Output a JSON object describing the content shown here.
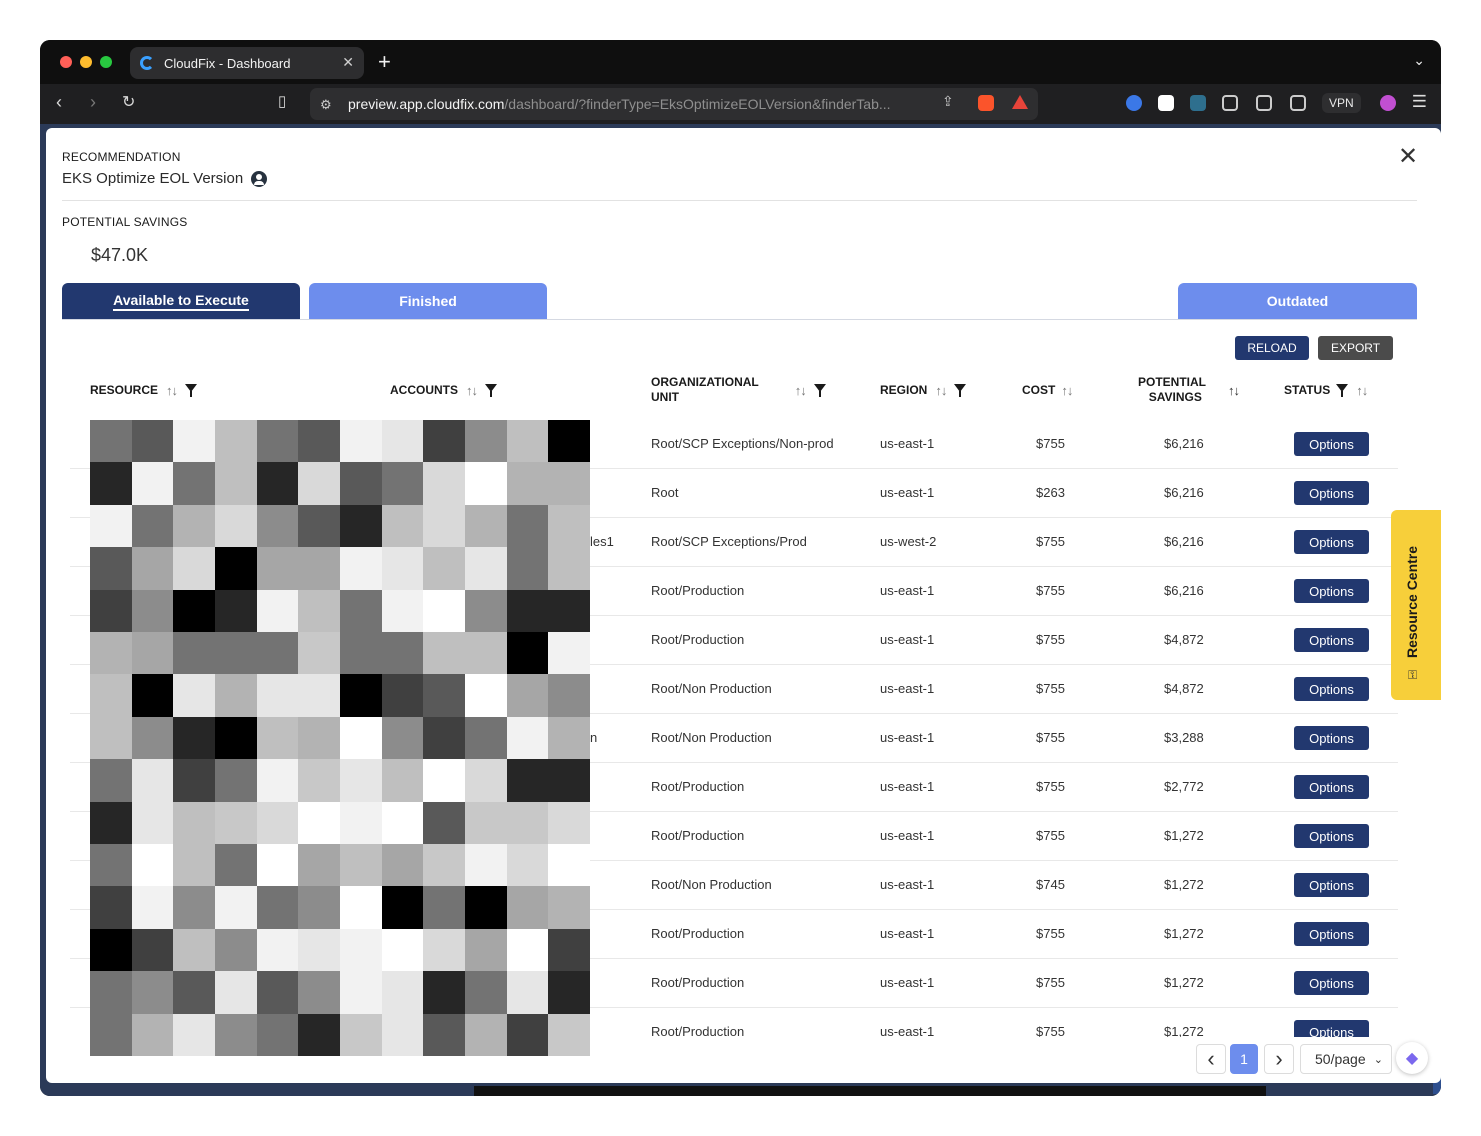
{
  "browser": {
    "tab_title": "CloudFix - Dashboard",
    "new_tab": "+",
    "url_host": "preview.app.cloudfix.com",
    "url_path": "/dashboard/?finderType=EksOptimizeEOLVersion&finderTab...",
    "vpn_label": "VPN",
    "shield_count": "10"
  },
  "modal": {
    "recommendation_label": "RECOMMENDATION",
    "recommendation_name": "EKS Optimize EOL Version",
    "close": "✕",
    "potential_savings_label": "POTENTIAL SAVINGS",
    "potential_savings_value": "$47.0K"
  },
  "tabs": {
    "available": "Available to Execute",
    "finished": "Finished",
    "outdated": "Outdated"
  },
  "actions": {
    "reload": "RELOAD",
    "export": "EXPORT"
  },
  "columns": {
    "resource": "RESOURCE",
    "accounts": "ACCOUNTS",
    "org_unit_line1": "ORGANIZATIONAL",
    "org_unit_line2": "UNIT",
    "region": "REGION",
    "cost": "COST",
    "savings_line1": "POTENTIAL",
    "savings_line2": "SAVINGS",
    "status": "STATUS"
  },
  "sort_glyph": "↑↓",
  "rows": [
    {
      "account_tail": "",
      "org_unit": "Root/SCP Exceptions/Non-prod",
      "region": "us-east-1",
      "cost": "$755",
      "savings": "$6,216",
      "status": "Options"
    },
    {
      "account_tail": "",
      "org_unit": "Root",
      "region": "us-east-1",
      "cost": "$263",
      "savings": "$6,216",
      "status": "Options"
    },
    {
      "account_tail": "les1",
      "org_unit": "Root/SCP Exceptions/Prod",
      "region": "us-west-2",
      "cost": "$755",
      "savings": "$6,216",
      "status": "Options"
    },
    {
      "account_tail": "",
      "org_unit": "Root/Production",
      "region": "us-east-1",
      "cost": "$755",
      "savings": "$6,216",
      "status": "Options"
    },
    {
      "account_tail": "",
      "org_unit": "Root/Production",
      "region": "us-east-1",
      "cost": "$755",
      "savings": "$4,872",
      "status": "Options"
    },
    {
      "account_tail": "",
      "org_unit": "Root/Non Production",
      "region": "us-east-1",
      "cost": "$755",
      "savings": "$4,872",
      "status": "Options"
    },
    {
      "account_tail": "n",
      "org_unit": "Root/Non Production",
      "region": "us-east-1",
      "cost": "$755",
      "savings": "$3,288",
      "status": "Options"
    },
    {
      "account_tail": "",
      "org_unit": "Root/Production",
      "region": "us-east-1",
      "cost": "$755",
      "savings": "$2,772",
      "status": "Options"
    },
    {
      "account_tail": "",
      "org_unit": "Root/Production",
      "region": "us-east-1",
      "cost": "$755",
      "savings": "$1,272",
      "status": "Options"
    },
    {
      "account_tail": "",
      "org_unit": "Root/Non Production",
      "region": "us-east-1",
      "cost": "$745",
      "savings": "$1,272",
      "status": "Options"
    },
    {
      "account_tail": "",
      "org_unit": "Root/Production",
      "region": "us-east-1",
      "cost": "$755",
      "savings": "$1,272",
      "status": "Options"
    },
    {
      "account_tail": "",
      "org_unit": "Root/Production",
      "region": "us-east-1",
      "cost": "$755",
      "savings": "$1,272",
      "status": "Options"
    },
    {
      "account_tail": "",
      "org_unit": "Root/Production",
      "region": "us-east-1",
      "cost": "$755",
      "savings": "$1,272",
      "status": "Options"
    }
  ],
  "pagination": {
    "prev": "‹",
    "current_page": "1",
    "next": "›",
    "page_size": "50/page"
  },
  "resource_centre": "Resource Centre",
  "colors": {
    "primary": "#22386f",
    "tab_inactive": "#6d8ded",
    "export": "#4b4b4b",
    "resource_centre": "#f7cf3a"
  },
  "icons": [
    "back-icon",
    "forward-icon",
    "reload-icon",
    "bookmark-icon",
    "share-icon",
    "brave-shield-icon",
    "close-icon",
    "user-circle-icon",
    "sort-icon",
    "filter-icon",
    "chevron-left-icon",
    "chevron-right-icon",
    "chevron-down-icon",
    "clickup-icon",
    "key-icon"
  ]
}
